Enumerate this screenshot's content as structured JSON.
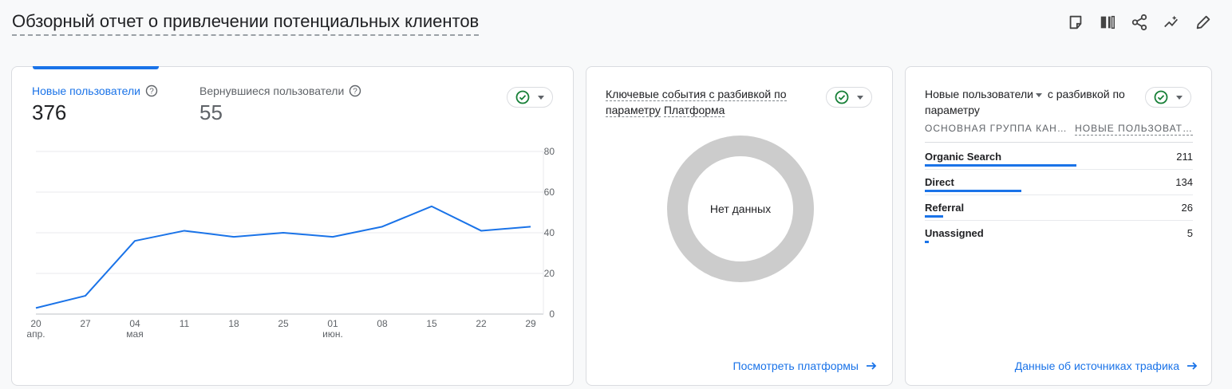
{
  "header": {
    "title": "Обзорный отчет о привлечении потенциальных клиентов",
    "toolbar": [
      {
        "icon": "note-icon"
      },
      {
        "icon": "compare-columns-icon"
      },
      {
        "icon": "share-icon"
      },
      {
        "icon": "insights-icon"
      },
      {
        "icon": "edit-pencil-icon"
      }
    ]
  },
  "card1": {
    "metric1": {
      "label": "Новые пользователи",
      "value": "376",
      "color": "#1a73e8"
    },
    "metric2": {
      "label": "Вернувшиеся пользователи",
      "value": "55"
    },
    "chart_data": {
      "type": "line",
      "x": [
        "20 апр.",
        "27",
        "04 мая",
        "11",
        "18",
        "25",
        "01 июн.",
        "08",
        "15",
        "22",
        "29"
      ],
      "x_tick_labels": [
        [
          "20",
          "апр."
        ],
        [
          "27",
          ""
        ],
        [
          "04",
          "мая"
        ],
        [
          "11",
          ""
        ],
        [
          "18",
          ""
        ],
        [
          "25",
          ""
        ],
        [
          "01",
          "июн."
        ],
        [
          "08",
          ""
        ],
        [
          "15",
          ""
        ],
        [
          "22",
          ""
        ],
        [
          "29",
          ""
        ]
      ],
      "series": [
        {
          "values": [
            3,
            9,
            36,
            41,
            38,
            40,
            38,
            43,
            53,
            41,
            43
          ],
          "color": "#1a73e8"
        }
      ],
      "y_ticks": [
        0,
        20,
        40,
        60,
        80
      ],
      "ylim": [
        0,
        80
      ],
      "grid": true,
      "y_axis_position": "right"
    }
  },
  "card2": {
    "title_prefix": "Ключевые события с разбивкой по параметру",
    "title_dimension": "Платформа",
    "empty_text": "Нет данных",
    "link": "Посмотреть платформы"
  },
  "card3": {
    "title_metric": "Новые пользователи",
    "title_suffix": "с разбивкой по параметру",
    "col1": "ОСНОВНАЯ ГРУППА КАН…",
    "col2": "НОВЫЕ ПОЛЬЗОВАТ…",
    "rows": [
      {
        "name": "Organic Search",
        "value": "211"
      },
      {
        "name": "Direct",
        "value": "134"
      },
      {
        "name": "Referral",
        "value": "26"
      },
      {
        "name": "Unassigned",
        "value": "5"
      }
    ],
    "link": "Данные об источниках трафика"
  }
}
